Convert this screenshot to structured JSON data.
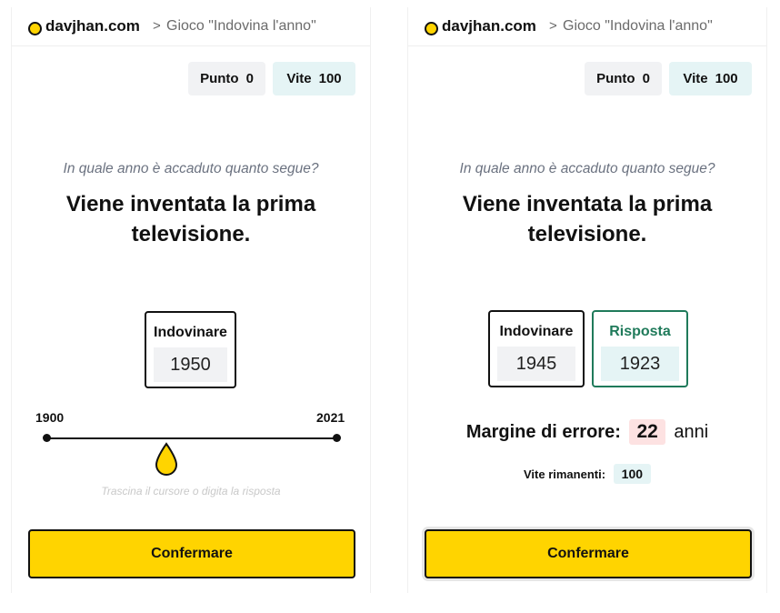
{
  "header": {
    "brand": "davjhan.com",
    "separator": ">",
    "breadcrumb": "Gioco \"Indovina l'anno\"",
    "logo_color": "#FFD400"
  },
  "stats": {
    "score_label": "Punto",
    "score_value": "0",
    "lives_label": "Vite",
    "lives_value": "100"
  },
  "prompt": "In quale anno è accaduto quanto segue?",
  "question": "Viene inventata la prima televisione.",
  "left_panel": {
    "guess_label": "Indovinare",
    "guess_value": "1950",
    "slider": {
      "min_label": "1900",
      "max_label": "2021",
      "min": 1900,
      "max": 2021,
      "value": 1950,
      "hint": "Trascina il cursore o digita la risposta"
    },
    "confirm_label": "Confermare"
  },
  "right_panel": {
    "guess_label": "Indovinare",
    "guess_value": "1945",
    "answer_label": "Risposta",
    "answer_value": "1923",
    "margin_label": "Margine di errore:",
    "margin_value": "22",
    "margin_unit": "anni",
    "lives_remaining_label": "Vite rimanenti:",
    "lives_remaining_value": "100",
    "confirm_label": "Confermare"
  },
  "colors": {
    "accent": "#FFD400",
    "answer": "#1f7a5a",
    "lives_bg": "#e5f4f5",
    "margin_bg": "#fde2e2"
  }
}
